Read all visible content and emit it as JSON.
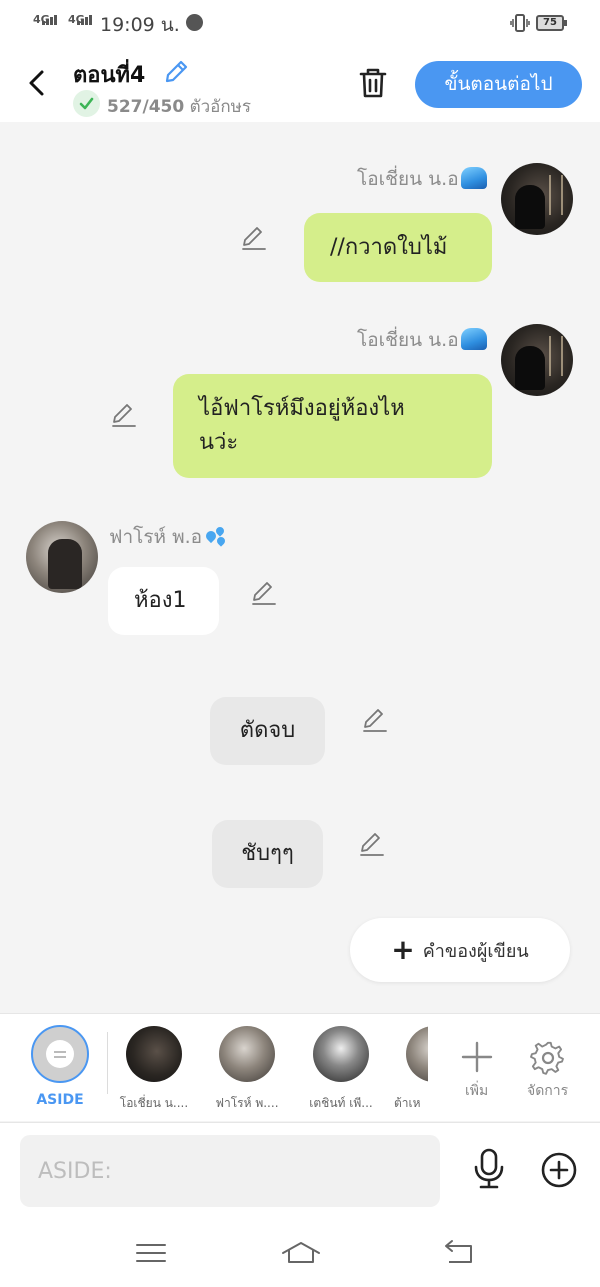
{
  "status_bar": {
    "network1": "4G",
    "network2": "4G",
    "time": "19:09 น.",
    "battery": "75"
  },
  "header": {
    "title": "ตอนที่4",
    "count_current": "527/450",
    "count_unit": "ตัวอักษร",
    "next_label": "ขั้นตอนต่อไป"
  },
  "messages": [
    {
      "sender": "โอเชี่ยน น.อ",
      "text": "//กวาดใบไม้"
    },
    {
      "sender": "โอเชี่ยน น.อ",
      "line1": "ไอ้ฟาโรห์มึงอยู่ห้องไห",
      "line2": "นว่ะ"
    },
    {
      "sender": "ฟาโรห์ พ.อ",
      "text": "ห้อง1"
    },
    {
      "text": "ตัดจบ"
    },
    {
      "text": "ชับๆๆ"
    }
  ],
  "writer_button": "คำของผู้เขียน",
  "characters": [
    {
      "label": "ASIDE"
    },
    {
      "label": "โอเชี่ยน น...."
    },
    {
      "label": "ฟาโรห์ พ...."
    },
    {
      "label": "เตชินท์ เพี..."
    },
    {
      "label": "ต้าเห"
    }
  ],
  "tools": {
    "add": "เพิ่ม",
    "manage": "จัดการ"
  },
  "input": {
    "placeholder": "ASIDE:"
  }
}
